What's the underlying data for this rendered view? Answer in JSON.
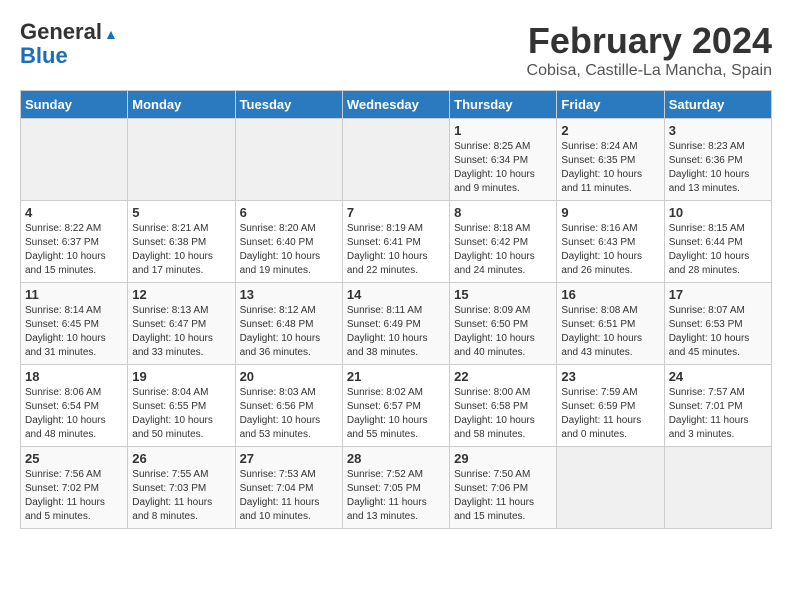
{
  "header": {
    "logo_general": "General",
    "logo_blue": "Blue",
    "month_title": "February 2024",
    "location": "Cobisa, Castille-La Mancha, Spain"
  },
  "days_of_week": [
    "Sunday",
    "Monday",
    "Tuesday",
    "Wednesday",
    "Thursday",
    "Friday",
    "Saturday"
  ],
  "weeks": [
    [
      {
        "day": "",
        "info": ""
      },
      {
        "day": "",
        "info": ""
      },
      {
        "day": "",
        "info": ""
      },
      {
        "day": "",
        "info": ""
      },
      {
        "day": "1",
        "info": "Sunrise: 8:25 AM\nSunset: 6:34 PM\nDaylight: 10 hours\nand 9 minutes."
      },
      {
        "day": "2",
        "info": "Sunrise: 8:24 AM\nSunset: 6:35 PM\nDaylight: 10 hours\nand 11 minutes."
      },
      {
        "day": "3",
        "info": "Sunrise: 8:23 AM\nSunset: 6:36 PM\nDaylight: 10 hours\nand 13 minutes."
      }
    ],
    [
      {
        "day": "4",
        "info": "Sunrise: 8:22 AM\nSunset: 6:37 PM\nDaylight: 10 hours\nand 15 minutes."
      },
      {
        "day": "5",
        "info": "Sunrise: 8:21 AM\nSunset: 6:38 PM\nDaylight: 10 hours\nand 17 minutes."
      },
      {
        "day": "6",
        "info": "Sunrise: 8:20 AM\nSunset: 6:40 PM\nDaylight: 10 hours\nand 19 minutes."
      },
      {
        "day": "7",
        "info": "Sunrise: 8:19 AM\nSunset: 6:41 PM\nDaylight: 10 hours\nand 22 minutes."
      },
      {
        "day": "8",
        "info": "Sunrise: 8:18 AM\nSunset: 6:42 PM\nDaylight: 10 hours\nand 24 minutes."
      },
      {
        "day": "9",
        "info": "Sunrise: 8:16 AM\nSunset: 6:43 PM\nDaylight: 10 hours\nand 26 minutes."
      },
      {
        "day": "10",
        "info": "Sunrise: 8:15 AM\nSunset: 6:44 PM\nDaylight: 10 hours\nand 28 minutes."
      }
    ],
    [
      {
        "day": "11",
        "info": "Sunrise: 8:14 AM\nSunset: 6:45 PM\nDaylight: 10 hours\nand 31 minutes."
      },
      {
        "day": "12",
        "info": "Sunrise: 8:13 AM\nSunset: 6:47 PM\nDaylight: 10 hours\nand 33 minutes."
      },
      {
        "day": "13",
        "info": "Sunrise: 8:12 AM\nSunset: 6:48 PM\nDaylight: 10 hours\nand 36 minutes."
      },
      {
        "day": "14",
        "info": "Sunrise: 8:11 AM\nSunset: 6:49 PM\nDaylight: 10 hours\nand 38 minutes."
      },
      {
        "day": "15",
        "info": "Sunrise: 8:09 AM\nSunset: 6:50 PM\nDaylight: 10 hours\nand 40 minutes."
      },
      {
        "day": "16",
        "info": "Sunrise: 8:08 AM\nSunset: 6:51 PM\nDaylight: 10 hours\nand 43 minutes."
      },
      {
        "day": "17",
        "info": "Sunrise: 8:07 AM\nSunset: 6:53 PM\nDaylight: 10 hours\nand 45 minutes."
      }
    ],
    [
      {
        "day": "18",
        "info": "Sunrise: 8:06 AM\nSunset: 6:54 PM\nDaylight: 10 hours\nand 48 minutes."
      },
      {
        "day": "19",
        "info": "Sunrise: 8:04 AM\nSunset: 6:55 PM\nDaylight: 10 hours\nand 50 minutes."
      },
      {
        "day": "20",
        "info": "Sunrise: 8:03 AM\nSunset: 6:56 PM\nDaylight: 10 hours\nand 53 minutes."
      },
      {
        "day": "21",
        "info": "Sunrise: 8:02 AM\nSunset: 6:57 PM\nDaylight: 10 hours\nand 55 minutes."
      },
      {
        "day": "22",
        "info": "Sunrise: 8:00 AM\nSunset: 6:58 PM\nDaylight: 10 hours\nand 58 minutes."
      },
      {
        "day": "23",
        "info": "Sunrise: 7:59 AM\nSunset: 6:59 PM\nDaylight: 11 hours\nand 0 minutes."
      },
      {
        "day": "24",
        "info": "Sunrise: 7:57 AM\nSunset: 7:01 PM\nDaylight: 11 hours\nand 3 minutes."
      }
    ],
    [
      {
        "day": "25",
        "info": "Sunrise: 7:56 AM\nSunset: 7:02 PM\nDaylight: 11 hours\nand 5 minutes."
      },
      {
        "day": "26",
        "info": "Sunrise: 7:55 AM\nSunset: 7:03 PM\nDaylight: 11 hours\nand 8 minutes."
      },
      {
        "day": "27",
        "info": "Sunrise: 7:53 AM\nSunset: 7:04 PM\nDaylight: 11 hours\nand 10 minutes."
      },
      {
        "day": "28",
        "info": "Sunrise: 7:52 AM\nSunset: 7:05 PM\nDaylight: 11 hours\nand 13 minutes."
      },
      {
        "day": "29",
        "info": "Sunrise: 7:50 AM\nSunset: 7:06 PM\nDaylight: 11 hours\nand 15 minutes."
      },
      {
        "day": "",
        "info": ""
      },
      {
        "day": "",
        "info": ""
      }
    ]
  ]
}
